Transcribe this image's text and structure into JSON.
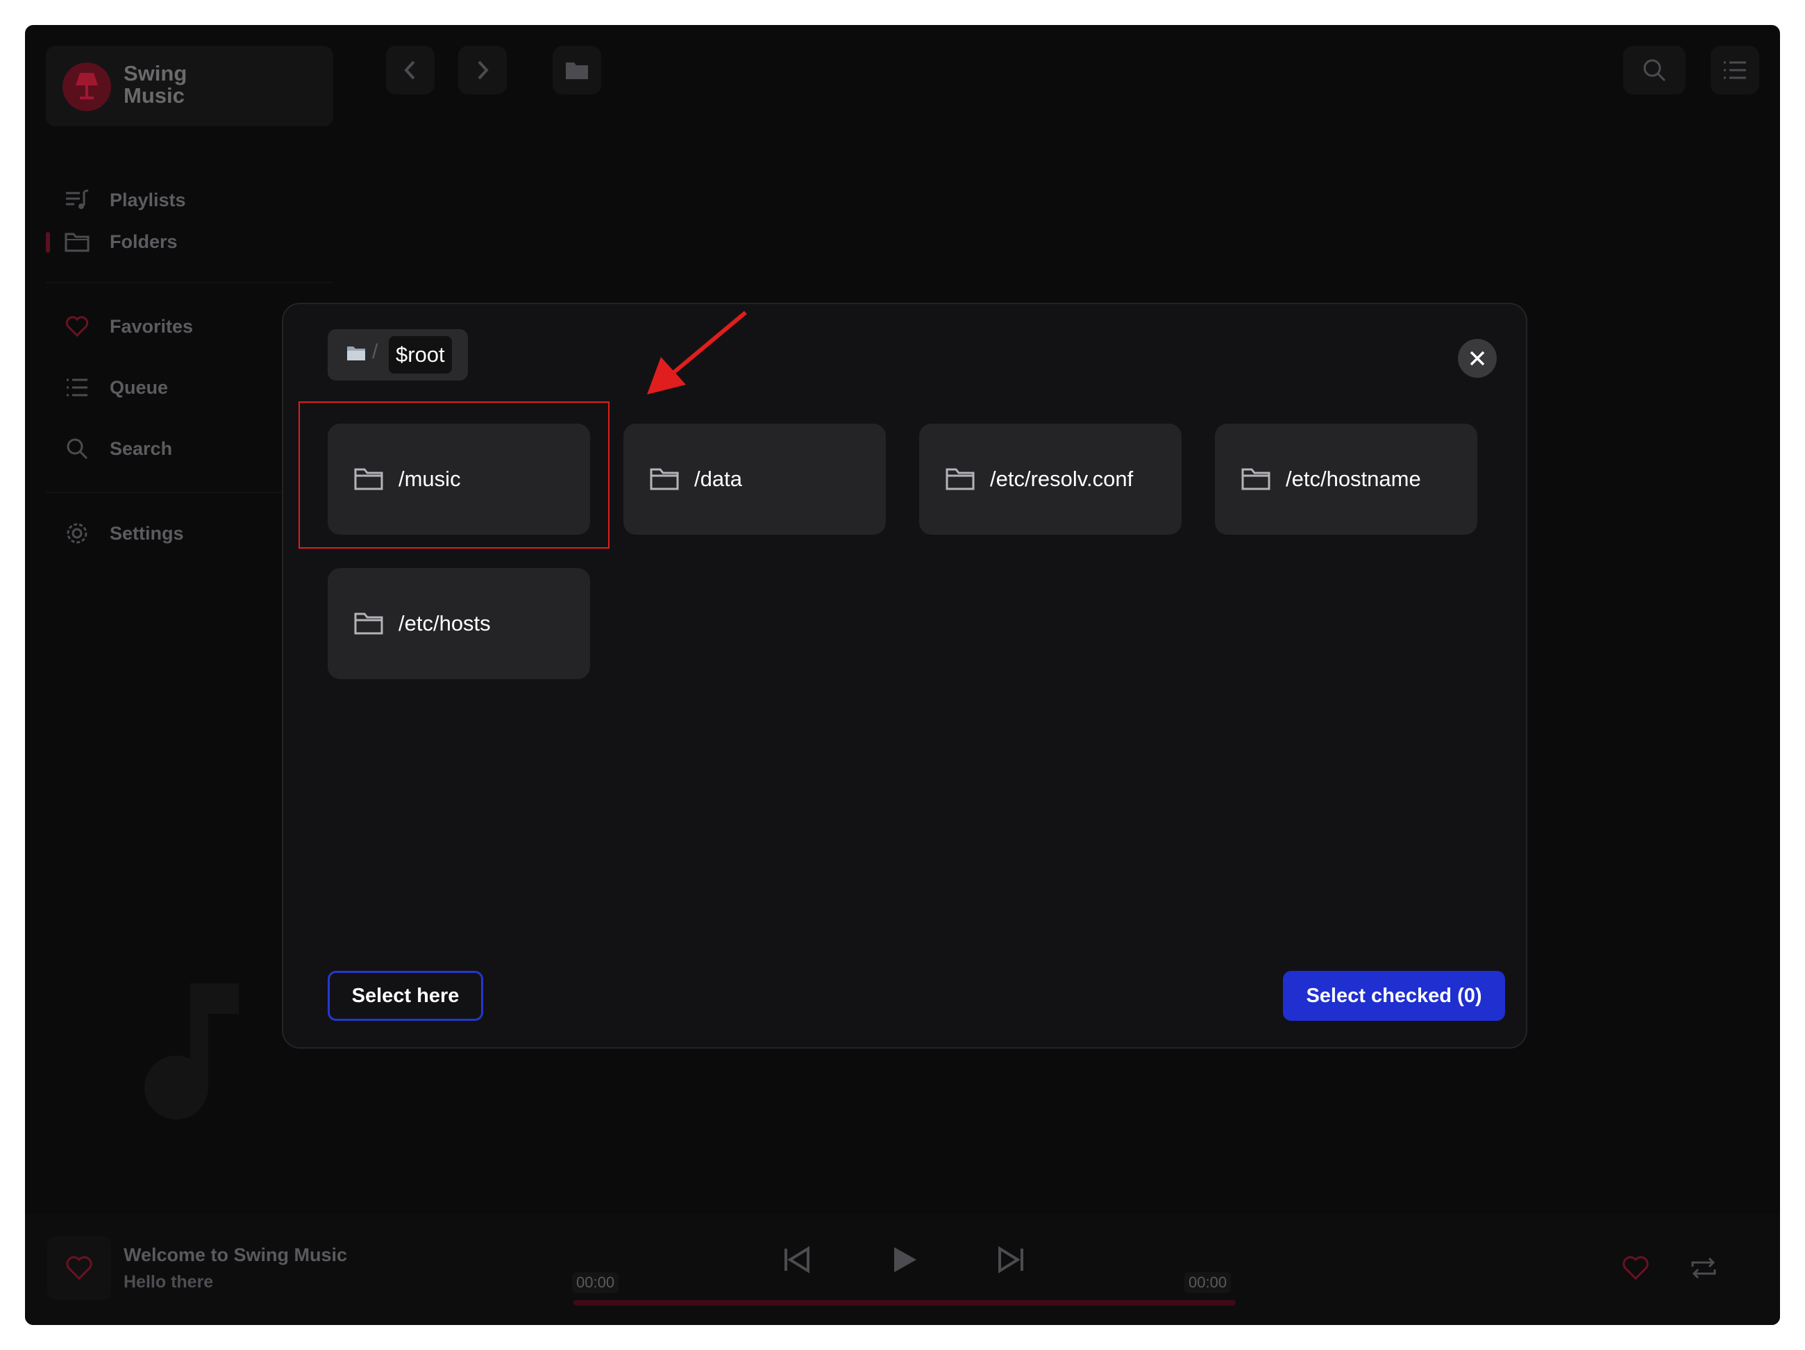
{
  "app": {
    "name": "Swing Music"
  },
  "sidebar": {
    "items": [
      {
        "label": "Playlists",
        "icon": "playlists-icon"
      },
      {
        "label": "Folders",
        "icon": "folder-music-icon",
        "active": true
      },
      {
        "label": "Favorites",
        "icon": "heart-icon"
      },
      {
        "label": "Queue",
        "icon": "queue-icon"
      },
      {
        "label": "Search",
        "icon": "search-icon"
      },
      {
        "label": "Settings",
        "icon": "gear-icon"
      }
    ]
  },
  "player": {
    "title": "Welcome to Swing Music",
    "subtitle": "Hello there",
    "elapsed": "00:00",
    "duration": "00:00"
  },
  "modal": {
    "breadcrumb": {
      "root_label": "$root"
    },
    "folders": [
      {
        "name": "/music"
      },
      {
        "name": "/data"
      },
      {
        "name": "/etc/resolv.conf"
      },
      {
        "name": "/etc/hostname"
      },
      {
        "name": "/etc/hosts"
      }
    ],
    "select_here_label": "Select here",
    "select_checked_label": "Select checked (0)"
  },
  "colors": {
    "accent_blue": "#1f2fd0",
    "brand_red": "#5b1020",
    "annotation_red": "#e01e1e"
  }
}
